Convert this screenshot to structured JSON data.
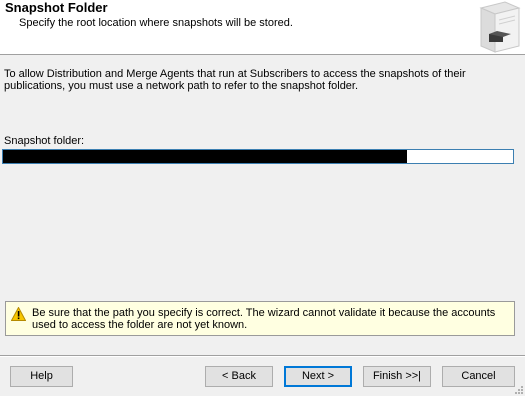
{
  "header": {
    "title": "Snapshot Folder",
    "subtitle": "Specify the root location where snapshots will be stored.",
    "icon": "server-icon"
  },
  "intro": {
    "text": "To allow Distribution and Merge Agents that run at Subscribers to access the snapshots of their publications, you must use a network path to refer to the snapshot folder."
  },
  "snapshot_folder": {
    "label": "Snapshot folder:",
    "value": ""
  },
  "warning": {
    "icon": "warning-icon",
    "text": "Be sure that the path you specify is correct. The wizard cannot validate it because the accounts used to access the folder are not yet known."
  },
  "buttons": {
    "help": "Help",
    "back": "< Back",
    "next": "Next >",
    "finish": "Finish >>|",
    "cancel": "Cancel"
  },
  "colors": {
    "accent": "#0078d7",
    "warning_bg": "#ffffe1",
    "window_bg": "#f0f0f0"
  }
}
